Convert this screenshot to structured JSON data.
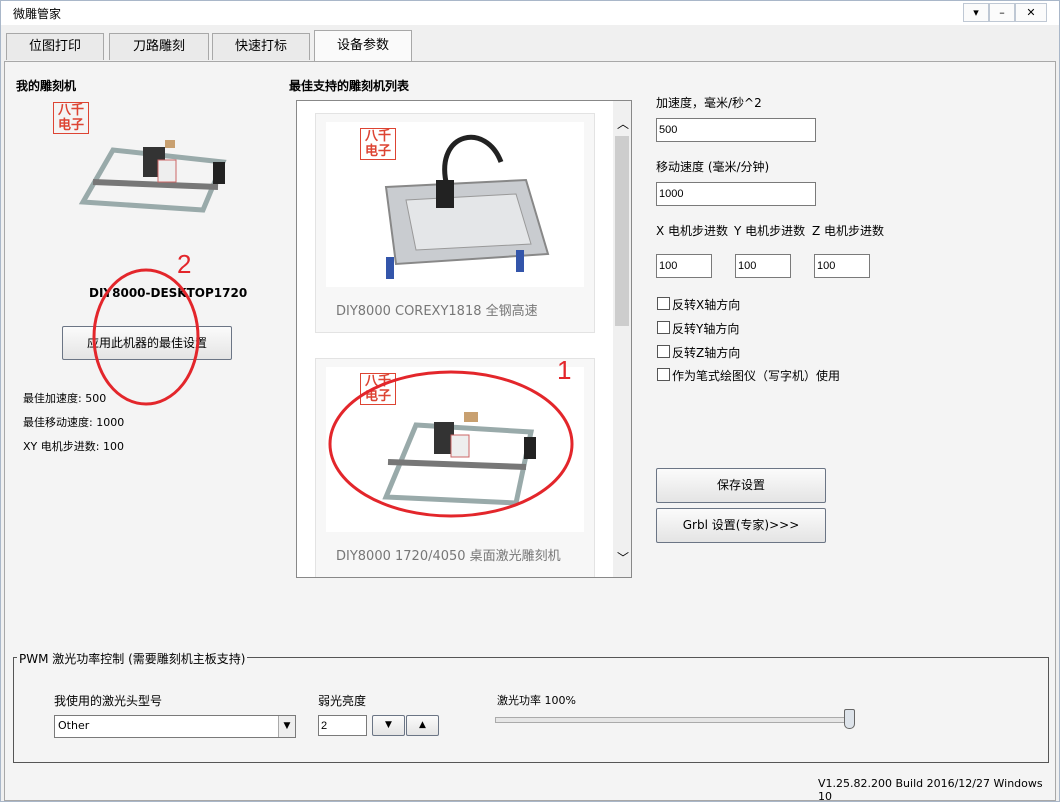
{
  "window": {
    "title": "微雕管家",
    "controls": [
      "▾",
      "–",
      "✕"
    ]
  },
  "tabs": [
    "位图打印",
    "刀路雕刻",
    "快速打标",
    "设备参数"
  ],
  "left": {
    "section_title": "我的雕刻机",
    "machine_name": "DIY8000-DESKTOP1720",
    "apply_button": "应用此机器的最佳设置",
    "stats": [
      "最佳加速度: 500",
      "最佳移动速度: 1000",
      "XY 电机步进数: 100"
    ]
  },
  "middle": {
    "section_title": "最佳支持的雕刻机列表",
    "logo_text": "八千\n电子",
    "machines": [
      {
        "name": "DIY8000 COREXY1818 全钢高速"
      },
      {
        "name": "DIY8000 1720/4050 桌面激光雕刻机"
      }
    ]
  },
  "params": {
    "accel_label": "加速度，毫米/秒^2",
    "accel_value": "500",
    "speed_label": "移动速度 (毫米/分钟)",
    "speed_value": "1000",
    "x_steps_label": "X 电机步进数",
    "y_steps_label": "Y 电机步进数",
    "z_steps_label": "Z 电机步进数",
    "x_steps": "100",
    "y_steps": "100",
    "z_steps": "100",
    "checks": [
      "反转X轴方向",
      "反转Y轴方向",
      "反转Z轴方向",
      "作为笔式绘图仪（写字机）使用"
    ],
    "save_button": "保存设置",
    "grbl_button": "Grbl 设置(专家)>>>"
  },
  "pwm": {
    "group_title": "PWM 激光功率控制 (需要雕刻机主板支持)",
    "laser_head_label": "我使用的激光头型号",
    "laser_head_value": "Other",
    "weak_light_label": "弱光亮度",
    "weak_light_value": "2",
    "power_label": "激光功率 100%",
    "power_fraction": 1.0
  },
  "annotations": [
    "1",
    "2"
  ],
  "footer": {
    "version": "V1.25.82.200 Build 2016/12/27 Windows 10"
  }
}
